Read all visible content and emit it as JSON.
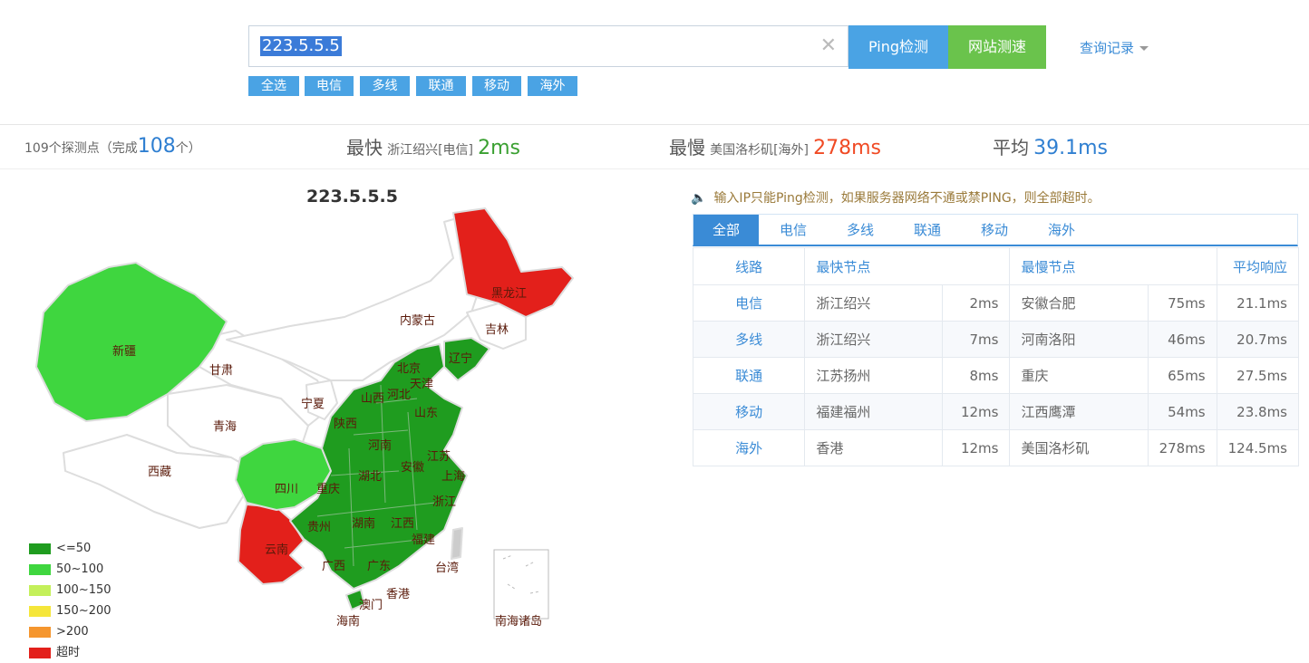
{
  "search": {
    "value": "223.5.5.5",
    "clear_icon": "close-icon",
    "ping_label": "Ping检测",
    "site_label": "网站测速",
    "history_label": "查询记录",
    "colors": {
      "ping": "#4aa3e4",
      "site": "#6ac34c"
    }
  },
  "filters": [
    "全选",
    "电信",
    "多线",
    "联通",
    "移动",
    "海外"
  ],
  "stats": {
    "probe_prefix": "109个探测点（完成",
    "probe_done": "108",
    "probe_suffix": "个）",
    "fastest_label": "最快",
    "fastest_node": "浙江绍兴[电信]",
    "fastest_value": "2ms",
    "slowest_label": "最慢",
    "slowest_node": "美国洛杉矶[海外]",
    "slowest_value": "278ms",
    "average_label": "平均",
    "average_value": "39.1ms"
  },
  "map": {
    "title": "223.5.5.5",
    "labels": {
      "xinjiang": "新疆",
      "xizang": "西藏",
      "qinghai": "青海",
      "gansu": "甘肃",
      "neimenggu": "内蒙古",
      "heilongjiang": "黑龙江",
      "jilin": "吉林",
      "liaoning": "辽宁",
      "beijing": "北京",
      "tianjin": "天津",
      "hebei": "河北",
      "shanxi": "山西",
      "ningxia": "宁夏",
      "shaanxi": "陕西",
      "shandong": "山东",
      "henan": "河南",
      "jiangsu": "江苏",
      "anhui": "安徽",
      "shanghai": "上海",
      "hubei": "湖北",
      "sichuan": "四川",
      "chongqing": "重庆",
      "zhejiang": "浙江",
      "guizhou": "贵州",
      "hunan": "湖南",
      "jiangxi": "江西",
      "fujian": "福建",
      "yunnan": "云南",
      "guangxi": "广西",
      "guangdong": "广东",
      "taiwan": "台湾",
      "xianggang": "香港",
      "aomen": "澳门",
      "hainan": "海南",
      "nanhai": "南海诸岛"
    },
    "colors": {
      "fast": "#1f9c1f",
      "good": "#3fd63f",
      "mid": "#c4f05a",
      "warn": "#f5e63a",
      "slow": "#f5962e",
      "timeout": "#e3201b",
      "none": "#ffffff"
    },
    "legend": [
      {
        "label": "<=50",
        "color": "#1f9c1f"
      },
      {
        "label": "50~100",
        "color": "#3fd63f"
      },
      {
        "label": "100~150",
        "color": "#c4f05a"
      },
      {
        "label": "150~200",
        "color": "#f5e63a"
      },
      {
        "label": ">200",
        "color": "#f5962e"
      },
      {
        "label": "超时",
        "color": "#e3201b"
      }
    ]
  },
  "notice": {
    "icon": "speaker-icon",
    "text": "输入IP只能Ping检测，如果服务器网络不通或禁PING，则全部超时。"
  },
  "tabs": [
    "全部",
    "电信",
    "多线",
    "联通",
    "移动",
    "海外"
  ],
  "table": {
    "headers": {
      "line": "线路",
      "fastest": "最快节点",
      "slowest": "最慢节点",
      "avg": "平均响应"
    },
    "rows": [
      {
        "line": "电信",
        "fast_node": "浙江绍兴",
        "fast_ms": "2ms",
        "slow_node": "安徽合肥",
        "slow_ms": "75ms",
        "avg": "21.1ms"
      },
      {
        "line": "多线",
        "fast_node": "浙江绍兴",
        "fast_ms": "7ms",
        "slow_node": "河南洛阳",
        "slow_ms": "46ms",
        "avg": "20.7ms"
      },
      {
        "line": "联通",
        "fast_node": "江苏扬州",
        "fast_ms": "8ms",
        "slow_node": "重庆",
        "slow_ms": "65ms",
        "avg": "27.5ms"
      },
      {
        "line": "移动",
        "fast_node": "福建福州",
        "fast_ms": "12ms",
        "slow_node": "江西鹰潭",
        "slow_ms": "54ms",
        "avg": "23.8ms"
      },
      {
        "line": "海外",
        "fast_node": "香港",
        "fast_ms": "12ms",
        "slow_node": "美国洛杉矶",
        "slow_ms": "278ms",
        "avg": "124.5ms"
      }
    ]
  }
}
